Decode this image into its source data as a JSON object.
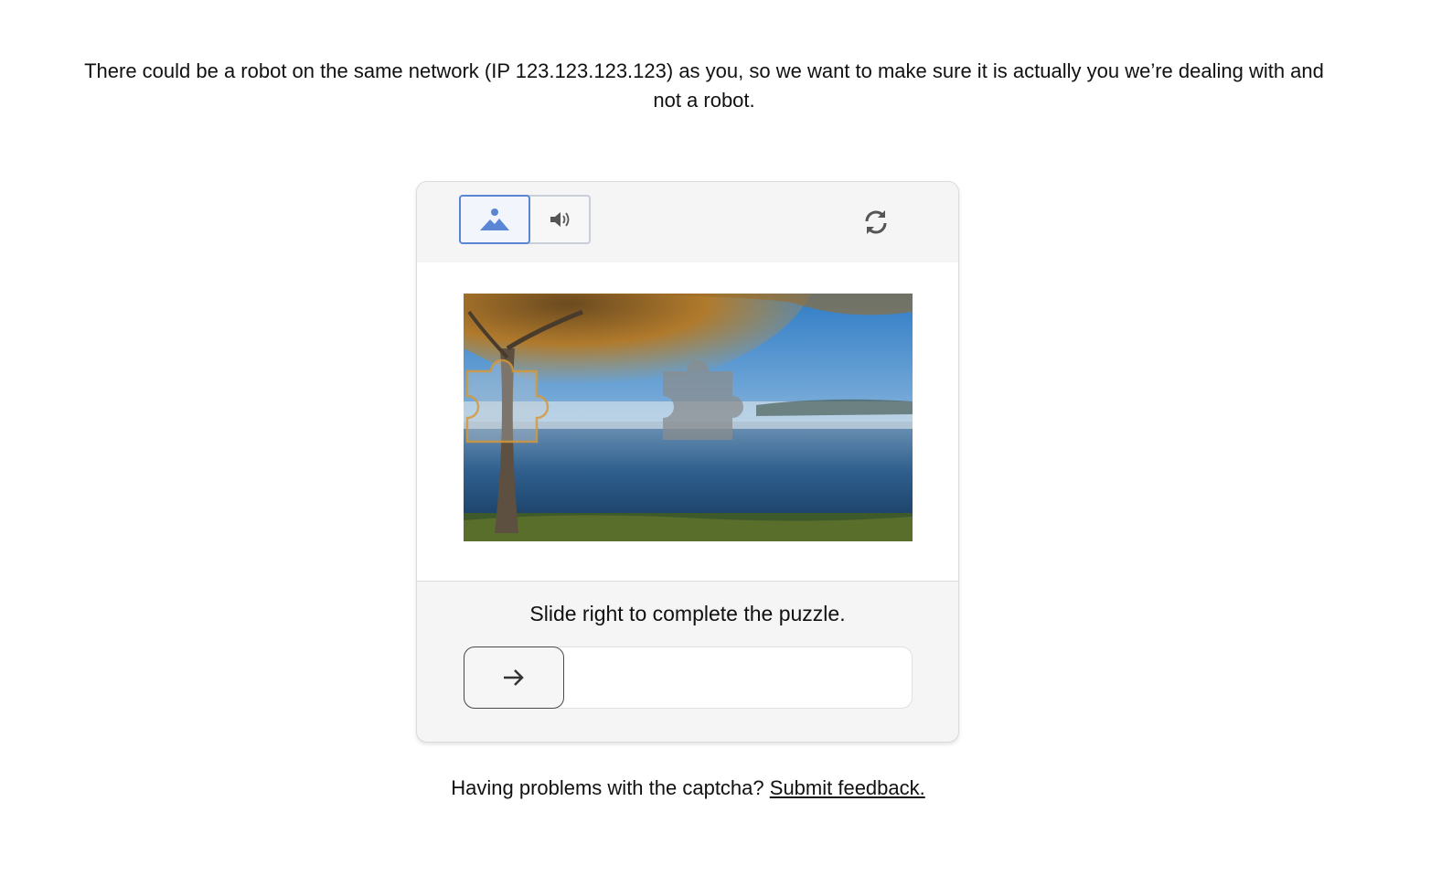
{
  "intro": {
    "text": "There could be a robot on the same network (IP 123.123.123.123) as you, so we want to make sure it is actually you we’re dealing with and not a robot."
  },
  "captcha": {
    "modes": [
      {
        "icon": "image-icon",
        "selected": true
      },
      {
        "icon": "speaker-icon",
        "selected": false
      }
    ],
    "refresh_icon": "refresh-icon",
    "instruction": "Slide right to complete the puzzle.",
    "slider": {
      "handle_icon": "arrow-right-icon",
      "progress": 0
    },
    "accent_color": "#5b86d6"
  },
  "footer": {
    "question": "Having problems with the captcha? ",
    "link_text": "Submit feedback."
  }
}
